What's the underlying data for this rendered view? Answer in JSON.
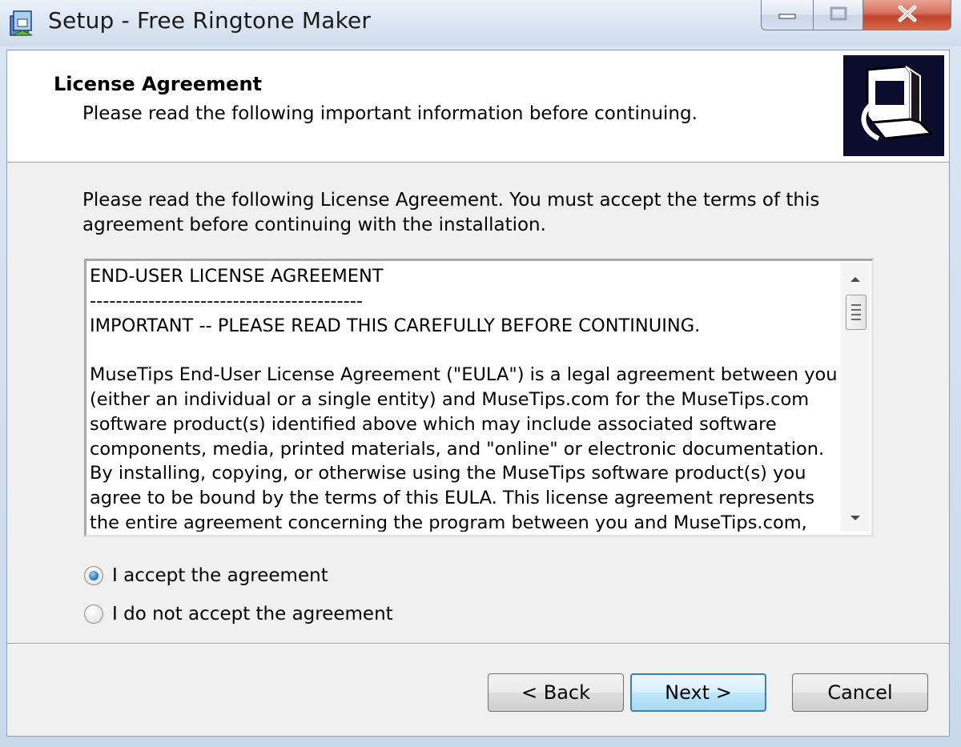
{
  "window": {
    "title": "Setup - Free Ringtone Maker"
  },
  "header": {
    "title": "License Agreement",
    "subtitle": "Please read the following important information before continuing."
  },
  "intro_text": "Please read the following License Agreement. You must accept the terms of this\nagreement before continuing with the installation.",
  "license_text": "END-USER LICENSE AGREEMENT\n------------------------------------------\nIMPORTANT -- PLEASE READ THIS CAREFULLY BEFORE CONTINUING.\n\nMuseTips End-User License Agreement (\"EULA\") is a legal agreement between you\n(either an individual or a single entity) and MuseTips.com for the MuseTips.com\nsoftware product(s) identified above which may include associated software\ncomponents, media, printed materials, and \"online\" or electronic documentation.\nBy installing, copying, or otherwise using the MuseTips software product(s) you\nagree to be bound by the terms of this EULA. This license agreement represents\nthe entire agreement concerning the program between you and MuseTips.com,",
  "options": {
    "accept_label": "I accept the agreement",
    "decline_label": "I do not accept the agreement",
    "selected": "accept"
  },
  "buttons": {
    "back": "< Back",
    "next": "Next >",
    "cancel": "Cancel"
  },
  "colors": {
    "header_image_bg": "#0b0d2e",
    "default_button_border": "#3c7fb1",
    "close_button": "#c2432a"
  }
}
